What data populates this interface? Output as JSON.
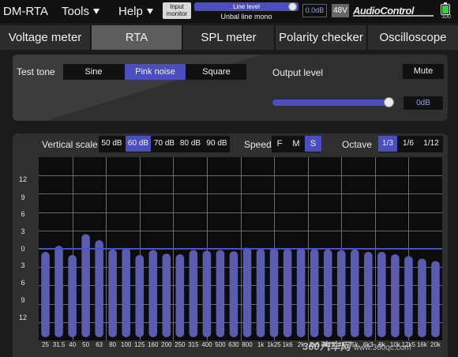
{
  "app_title": "DM-RTA",
  "menus": [
    "Tools",
    "Help"
  ],
  "input_monitor": "Input monitor",
  "input_level": {
    "selected": "Line level",
    "source": "Unbal line mono"
  },
  "input_gain": "0.0dB",
  "phantom": "48V",
  "brand": "AudioControl",
  "battery": "100",
  "tabs": [
    "Voltage meter",
    "RTA",
    "SPL meter",
    "Polarity checker",
    "Oscilloscope"
  ],
  "active_tab": "RTA",
  "test_tone": {
    "label": "Test tone",
    "options": [
      "Sine",
      "Pink noise",
      "Square"
    ],
    "selected": "Pink noise",
    "output_label": "Output level",
    "mute_label": "Mute",
    "output_value": "0dB",
    "output_level_fraction": 0.98
  },
  "rta_controls": {
    "vertical_scale_label": "Vertical scale",
    "vertical_scale_options": [
      "50 dB",
      "60 dB",
      "70 dB",
      "80 dB",
      "90 dB"
    ],
    "vertical_scale_selected": "60 dB",
    "speed_label": "Speed",
    "speed_options": [
      "F",
      "M",
      "S"
    ],
    "speed_selected": "S",
    "octave_label": "Octave",
    "octave_options": [
      "1/3",
      "1/6",
      "1/12"
    ],
    "octave_selected": "1/3"
  },
  "watermark": {
    "text": "360汽车网",
    "url": "www.360qc.com"
  },
  "colors": {
    "accent": "#4a4ec0",
    "bar": "#5a5cb0",
    "reference_line": "#4450d8",
    "grid": "#6a6a6a"
  },
  "chart_data": {
    "type": "bar",
    "categories": [
      "25",
      "31.5",
      "40",
      "50",
      "63",
      "80",
      "100",
      "125",
      "160",
      "200",
      "250",
      "315",
      "400",
      "500",
      "630",
      "800",
      "1k",
      "1k25",
      "1k6",
      "2k",
      "2k5",
      "3k15",
      "4k",
      "5k",
      "6k3",
      "8k",
      "10k",
      "12k5",
      "16k",
      "20k"
    ],
    "values": [
      -0.5,
      0.5,
      -1,
      2.4,
      1.4,
      -0.1,
      0.1,
      -1,
      -0.2,
      -0.8,
      -0.9,
      -0.2,
      -0.3,
      -0.2,
      -0.4,
      0.2,
      0.0,
      0.1,
      0.0,
      0.1,
      0.0,
      -0.1,
      -0.2,
      -0.1,
      -0.5,
      -0.5,
      -0.9,
      -1.2,
      -1.6,
      -2.0
    ],
    "y_ticks": [
      "12",
      "9",
      "6",
      "3",
      "0",
      "3",
      "6",
      "9",
      "12"
    ],
    "ylim": [
      -15,
      15
    ],
    "reference_level": 0,
    "grid": true
  }
}
